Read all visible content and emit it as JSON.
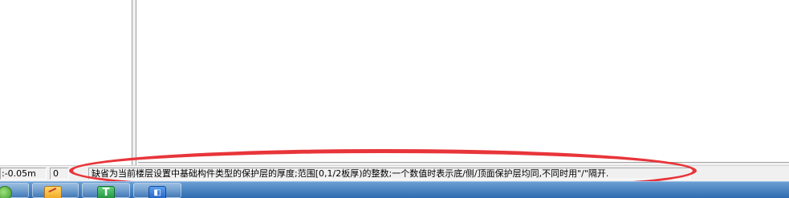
{
  "statusbar": {
    "elevation": ":-0.05m",
    "value": "0",
    "message": "缺省为当前楼层设置中基础构件类型的保护层的厚度;范围[0,1/2板厚)的整数;一个数值时表示底/侧/顶面保护层均同,不同时用\"/\"隔开."
  },
  "taskbar": {
    "icons": [
      "app-green-circle-icon",
      "notes-icon",
      "t-app-icon",
      "blue-app-icon"
    ],
    "t_glyph": "T",
    "blue_glyph": "◧"
  },
  "colors": {
    "highlight": "#e8353a",
    "taskbar_top": "#6a9fd3",
    "taskbar_bottom": "#2e6bb0",
    "statusbar_bg": "#f0f0f0"
  }
}
